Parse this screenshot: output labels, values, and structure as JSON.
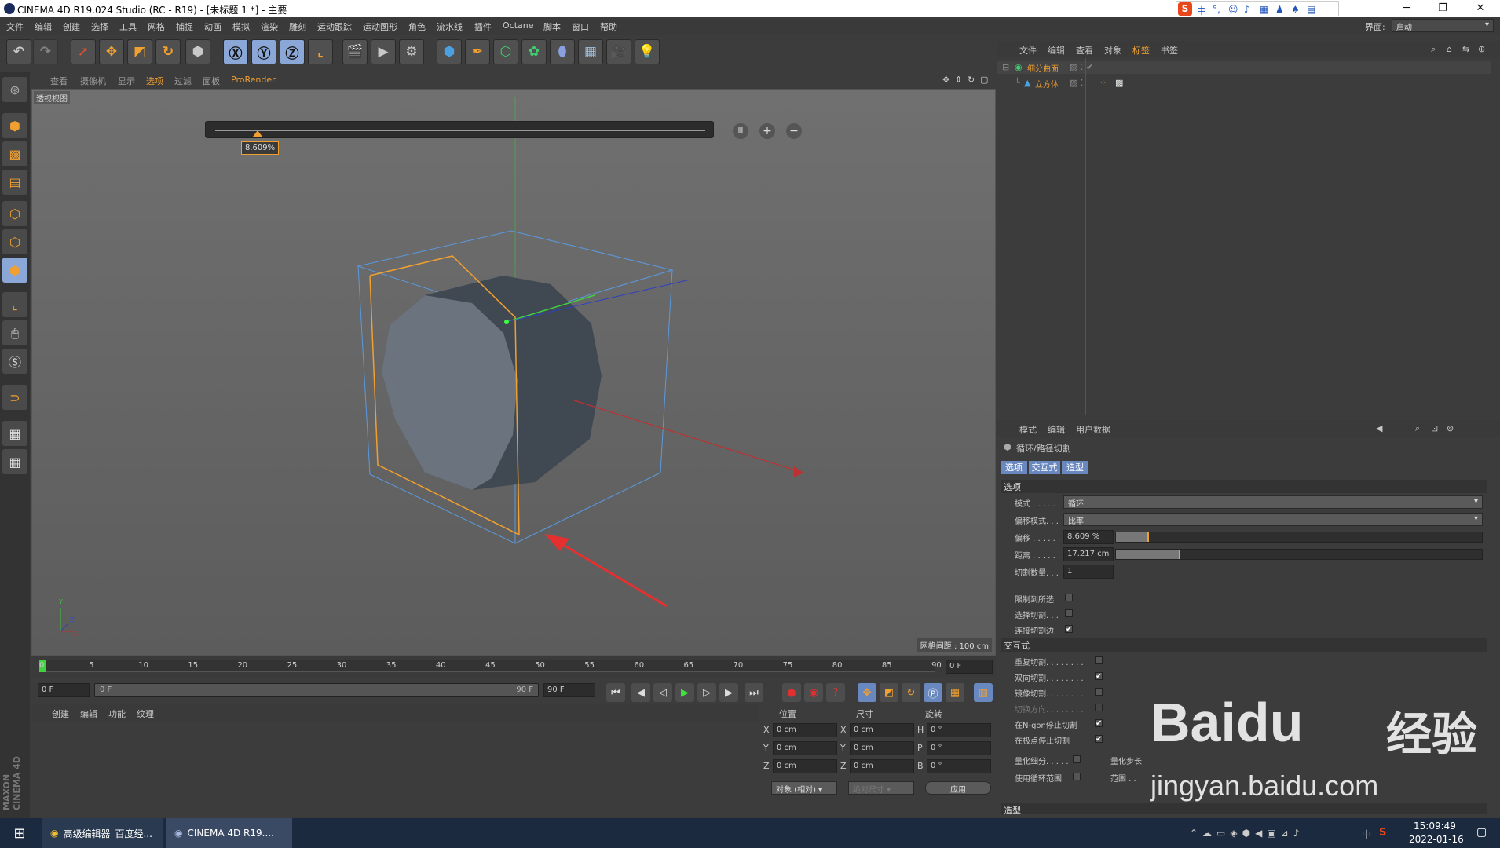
{
  "window": {
    "title": "CINEMA 4D R19.024 Studio (RC - R19) - [未标题 1 *] - 主要"
  },
  "menu": [
    "文件",
    "编辑",
    "创建",
    "选择",
    "工具",
    "网格",
    "捕捉",
    "动画",
    "模拟",
    "渲染",
    "雕刻",
    "运动跟踪",
    "运动图形",
    "角色",
    "流水线",
    "插件",
    "Octane",
    "脚本",
    "窗口",
    "帮助"
  ],
  "layout": {
    "label": "界面:",
    "value": "启动"
  },
  "viewport": {
    "menu": [
      "查看",
      "摄像机",
      "显示",
      "选项",
      "过滤",
      "面板",
      "ProRender"
    ],
    "name": "透视视图",
    "slider_value": "8.609%",
    "slider_fraction": 0.08609,
    "grid_info": "网格间距 : 100 cm",
    "axis": {
      "y": "Y",
      "x": "X",
      "z": "Z"
    }
  },
  "timeline": {
    "ticks": [
      "0",
      "5",
      "10",
      "15",
      "20",
      "25",
      "30",
      "35",
      "40",
      "45",
      "50",
      "55",
      "60",
      "65",
      "70",
      "75",
      "80",
      "85",
      "90"
    ],
    "current_frame": "0 F",
    "start_field": "0 F",
    "range_start": "0 F",
    "range_end": "90 F",
    "end_field": "90 F"
  },
  "materials": {
    "menu": [
      "创建",
      "编辑",
      "功能",
      "纹理"
    ]
  },
  "coords": {
    "headers": [
      "位置",
      "尺寸",
      "旋转"
    ],
    "rows": [
      {
        "a": "X",
        "v1": "0 cm",
        "b": "X",
        "v2": "0 cm",
        "c": "H",
        "v3": "0 °"
      },
      {
        "a": "Y",
        "v1": "0 cm",
        "b": "Y",
        "v2": "0 cm",
        "c": "P",
        "v3": "0 °"
      },
      {
        "a": "Z",
        "v1": "0 cm",
        "b": "Z",
        "v2": "0 cm",
        "c": "B",
        "v3": "0 °"
      }
    ],
    "mode": "对象 (相对)",
    "size_mode": "绝对尺寸",
    "apply": "应用"
  },
  "objects": {
    "menu": [
      "文件",
      "编辑",
      "查看",
      "对象",
      "标签",
      "书签"
    ],
    "items": [
      {
        "name": "细分曲面"
      },
      {
        "name": "立方体"
      }
    ]
  },
  "attributes": {
    "menu": [
      "模式",
      "编辑",
      "用户数据"
    ],
    "tool": "循环/路径切割",
    "tabs": [
      "选项",
      "交互式",
      "造型"
    ],
    "sections": {
      "options": "选项",
      "interactive": "交互式",
      "shape": "造型"
    },
    "fields": {
      "mode_label": "模式 . . . . . .",
      "mode_value": "循环",
      "offset_mode_label": "偏移模式. . .",
      "offset_mode_value": "比率",
      "offset_label": "偏移 . . . . . .",
      "offset_value": "8.609 %",
      "offset_fraction": 0.08609,
      "distance_label": "距离 . . . . . .",
      "distance_value": "17.217 cm",
      "distance_fraction": 0.17217,
      "count_label": "切割数量. . .",
      "count_value": "1",
      "limit_label": "限制到所选",
      "select_label": "选择切割. . .",
      "connect_label": "连接切割边",
      "repeat_label": "重复切割. . . . . . . .",
      "bidir_label": "双向切割. . . . . . . .",
      "mirror_label": "镜像切割. . . . . . . .",
      "flip_label": "切换方向. . . . . . . .",
      "ngon_label": "在N-gon停止切割",
      "pole_label": "在极点停止切割",
      "quant_label": "量化细分. . . . .",
      "quant_step_label": "量化步长",
      "range_label": "使用循环范围",
      "range2_label": "范围 . . ."
    }
  },
  "taskbar": {
    "items": [
      "高级编辑器_百度经...",
      "CINEMA 4D R19...."
    ],
    "time": "15:09:49",
    "date": "2022-01-16",
    "ime": "中"
  },
  "watermark": {
    "brand": "Baidu",
    "jingyan": "经验",
    "url": "jingyan.baidu.com"
  },
  "colors": {
    "accent": "#f0a030",
    "selection": "#8aa7d8",
    "arrow": "#e53030"
  }
}
